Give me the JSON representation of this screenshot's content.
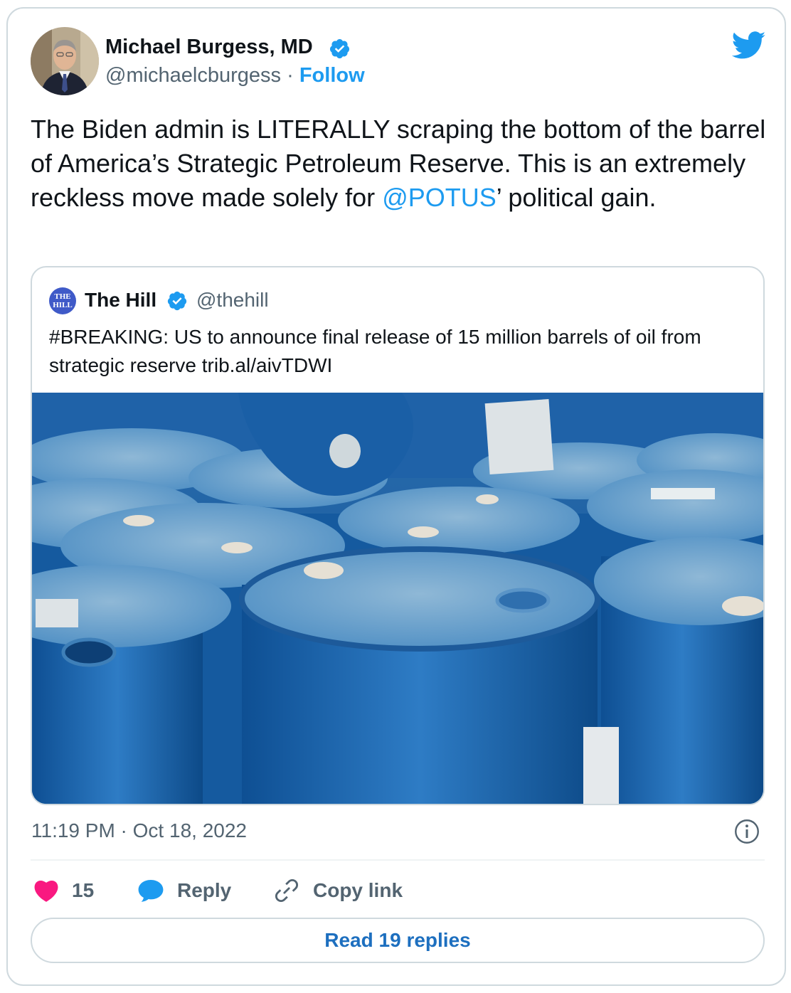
{
  "author": {
    "name": "Michael Burgess, MD",
    "handle": "@michaelcburgess",
    "separator": "·",
    "follow_label": "Follow"
  },
  "tweet": {
    "text_before": "The Biden admin is LITERALLY scraping the bottom of the barrel of America’s Strategic Petroleum Reserve. This is an extremely reckless move made solely for ",
    "mention": "@POTUS",
    "text_after": "’ political gain."
  },
  "quoted_tweet": {
    "avatar_text": "THE HILL",
    "name": "The Hill",
    "handle": "@thehill",
    "text": "#BREAKING: US to announce final release of 15 million barrels of oil from strategic reserve trib.al/aivTDWI",
    "image_subject": "blue oil barrels"
  },
  "timestamp": "11:19 PM · Oct 18, 2022",
  "actions": {
    "like_count": "15",
    "reply_label": "Reply",
    "copy_link_label": "Copy link"
  },
  "read_replies_label": "Read 19 replies",
  "icons": {
    "logo": "twitter-bird-icon",
    "verified": "verified-badge-icon",
    "like": "heart-icon",
    "reply": "speech-bubble-icon",
    "copy": "link-icon",
    "info": "info-icon"
  },
  "colors": {
    "accent": "#1d9bf0",
    "text": "#0f1419",
    "muted": "#536471",
    "like": "#f91880",
    "border": "#cfd9de"
  }
}
